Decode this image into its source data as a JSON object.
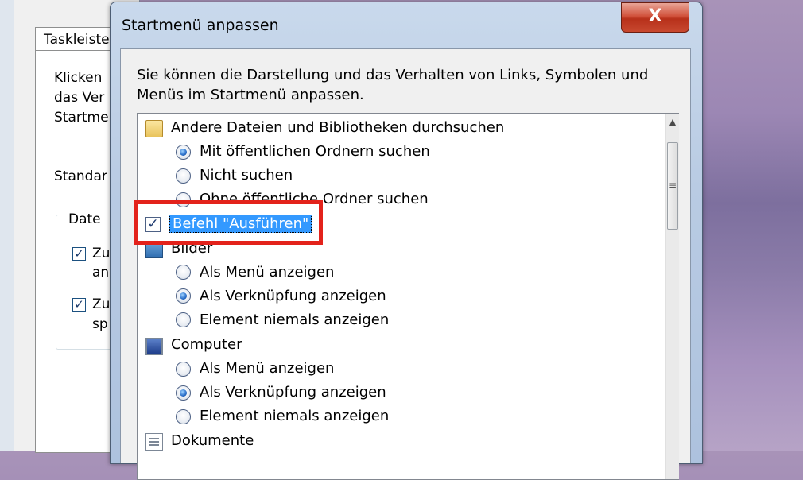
{
  "background_window": {
    "tab_label": "Taskleiste",
    "text_lines": [
      "Klicken",
      "das Ver",
      "Startme"
    ],
    "standard_label": "Standar",
    "group_label": "Date",
    "check1_label": [
      "Zu",
      "an"
    ],
    "check2_label": [
      "Zu",
      "sp"
    ]
  },
  "dialog": {
    "title": "Startmenü anpassen",
    "close_label": "X",
    "description": "Sie können die Darstellung und das Verhalten von Links, Symbolen und Menüs im Startmenü anpassen."
  },
  "list": {
    "items": [
      {
        "type": "category",
        "icon": "folder-icon",
        "label": "Andere Dateien und Bibliotheken durchsuchen"
      },
      {
        "type": "radio",
        "checked": true,
        "label": "Mit öffentlichen Ordnern suchen"
      },
      {
        "type": "radio",
        "checked": false,
        "label": "Nicht suchen"
      },
      {
        "type": "radio",
        "checked": false,
        "label": "Ohne öffentliche Ordner suchen"
      },
      {
        "type": "checkbox",
        "checked": true,
        "label": "Befehl \"Ausführen\""
      },
      {
        "type": "category",
        "icon": "pictures-icon",
        "label": "Bilder"
      },
      {
        "type": "radio",
        "checked": false,
        "label": "Als Menü anzeigen"
      },
      {
        "type": "radio",
        "checked": true,
        "label": "Als Verknüpfung anzeigen"
      },
      {
        "type": "radio",
        "checked": false,
        "label": "Element niemals anzeigen"
      },
      {
        "type": "category",
        "icon": "computer-icon",
        "label": "Computer"
      },
      {
        "type": "radio",
        "checked": false,
        "label": "Als Menü anzeigen"
      },
      {
        "type": "radio",
        "checked": true,
        "label": "Als Verknüpfung anzeigen"
      },
      {
        "type": "radio",
        "checked": false,
        "label": "Element niemals anzeigen"
      },
      {
        "type": "category",
        "icon": "document-icon",
        "label": "Dokumente"
      }
    ]
  },
  "scrollbar": {
    "up_arrow": "▲",
    "thumb_grip": "≡"
  },
  "colors": {
    "highlight": "#e3221b",
    "selection": "#3399ff"
  }
}
